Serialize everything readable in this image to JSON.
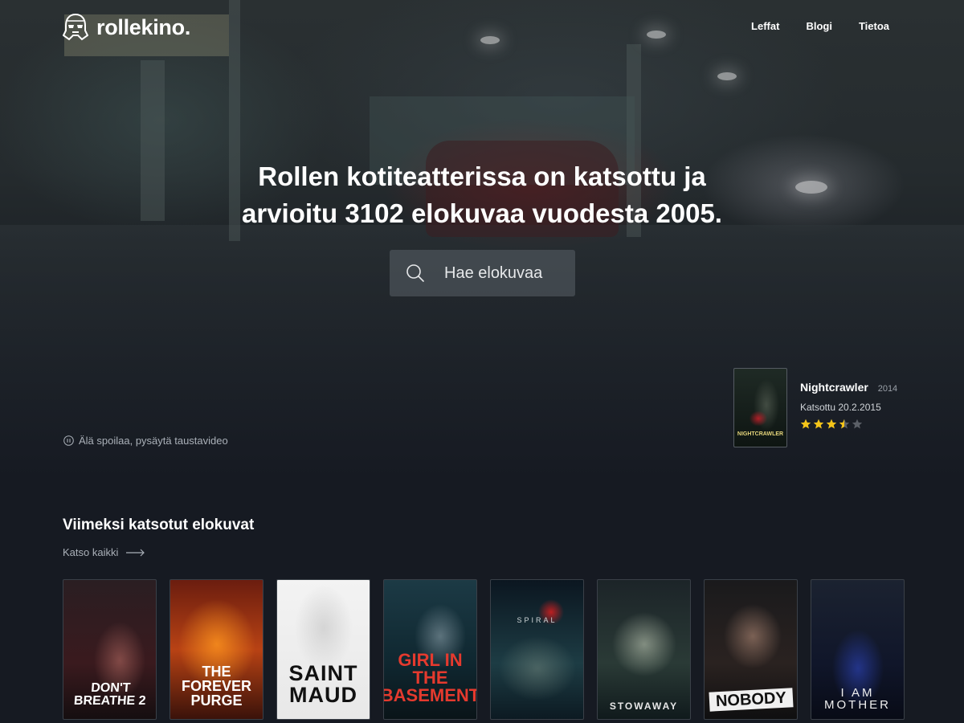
{
  "brand": {
    "name": "rollekino."
  },
  "nav": {
    "items": [
      "Leffat",
      "Blogi",
      "Tietoa"
    ]
  },
  "hero": {
    "headline_line1": "Rollen kotiteatterissa on katsottu ja",
    "headline_line2": "arvioitu 3102 elokuvaa vuodesta 2005.",
    "search_placeholder": "Hae elokuvaa",
    "pause_label": "Älä spoilaa, pysäytä taustavideo"
  },
  "featured": {
    "title": "Nightcrawler",
    "year": "2014",
    "seen": "Katsottu 20.2.2015",
    "poster_text": "NIGHTCRAWLER",
    "rating": 3.5,
    "rating_max": 5,
    "star_color": "#f5c518"
  },
  "recent": {
    "title": "Viimeksi katsotut elokuvat",
    "see_all": "Katso kaikki",
    "posters": [
      {
        "title": "DON'T\nBREATHE 2"
      },
      {
        "title": "THE FOREVER\nPURGE"
      },
      {
        "title": "SAINT\nMAUD"
      },
      {
        "title": "GIRL IN THE\nBASEMENT"
      },
      {
        "title": "SPIRAL"
      },
      {
        "title": "STOWAWAY"
      },
      {
        "title": "NOBODY"
      },
      {
        "title": "I AM\nMOTHER"
      }
    ]
  }
}
